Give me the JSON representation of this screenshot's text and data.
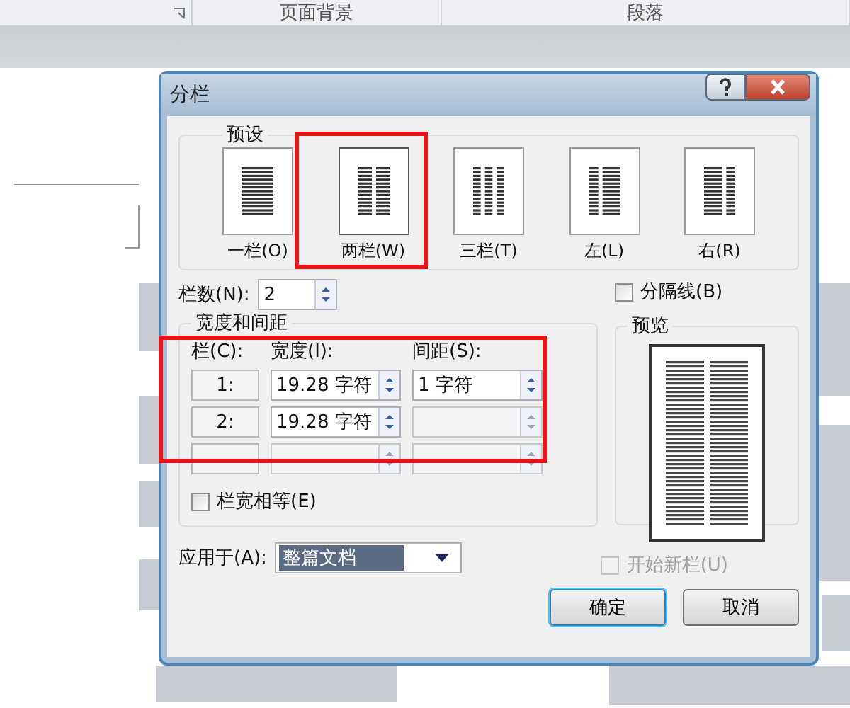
{
  "ribbon": {
    "groups": [
      "页面背景",
      "段落"
    ]
  },
  "dialog": {
    "title": "分栏",
    "presets": {
      "label": "预设",
      "items": [
        {
          "kind": "one",
          "label": "一栏(O)",
          "selected": false
        },
        {
          "kind": "two",
          "label": "两栏(W)",
          "selected": true
        },
        {
          "kind": "three",
          "label": "三栏(T)",
          "selected": false
        },
        {
          "kind": "left",
          "label": "左(L)",
          "selected": false
        },
        {
          "kind": "right",
          "label": "右(R)",
          "selected": false
        }
      ]
    },
    "column_count": {
      "label": "栏数(N):",
      "value": "2"
    },
    "line_between": {
      "label": "分隔线(B)",
      "checked": false
    },
    "width_spacing": {
      "label": "宽度和间距",
      "headers": [
        "栏(C):",
        "宽度(I):",
        "间距(S):"
      ],
      "rows": [
        {
          "number": "1:",
          "width": "19.28 字符",
          "width_disabled": false,
          "spacing": "1 字符",
          "spacing_disabled": false
        },
        {
          "number": "2:",
          "width": "19.28 字符",
          "width_disabled": false,
          "spacing_disabled": true
        },
        {
          "width_disabled": true,
          "spacing_disabled": true
        }
      ]
    },
    "equal_width": {
      "label": "栏宽相等(E)",
      "checked": false
    },
    "preview": {
      "label": "预览"
    },
    "apply_to": {
      "label": "应用于(A):",
      "value": "整篇文档"
    },
    "start_new": {
      "label": "开始新栏(U)",
      "checked": false,
      "disabled": true
    },
    "buttons": [
      {
        "label": "确定",
        "default": true
      },
      {
        "label": "取消",
        "default": false
      }
    ]
  },
  "annotations": [
    {
      "kind": "box"
    },
    {
      "kind": "box"
    }
  ]
}
